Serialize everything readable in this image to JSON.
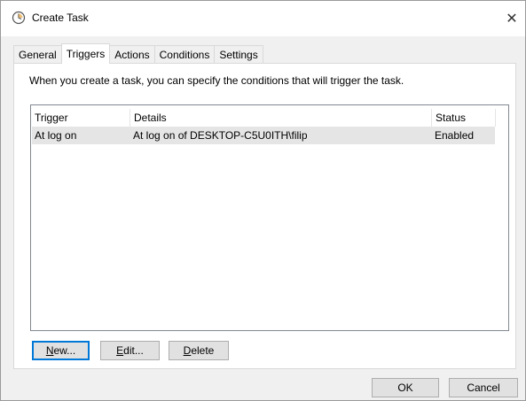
{
  "window": {
    "title": "Create Task",
    "close_glyph": "✕"
  },
  "tabs": [
    {
      "label": "General",
      "active": false
    },
    {
      "label": "Triggers",
      "active": true
    },
    {
      "label": "Actions",
      "active": false
    },
    {
      "label": "Conditions",
      "active": false
    },
    {
      "label": "Settings",
      "active": false
    }
  ],
  "triggers_panel": {
    "intro": "When you create a task, you can specify the conditions that will trigger the task.",
    "columns": [
      "Trigger",
      "Details",
      "Status"
    ],
    "rows": [
      {
        "trigger": "At log on",
        "details": "At log on of DESKTOP-C5U0ITH\\filip",
        "status": "Enabled",
        "selected": true
      }
    ],
    "buttons": {
      "new": {
        "mnemonic": "N",
        "rest": "ew..."
      },
      "edit": {
        "mnemonic": "E",
        "rest": "dit..."
      },
      "delete": {
        "mnemonic": "D",
        "rest": "elete"
      }
    }
  },
  "footer": {
    "ok": "OK",
    "cancel": "Cancel"
  },
  "colors": {
    "focus_border": "#0078d7",
    "selected_row": "#e5e5e5",
    "button_face": "#e1e1e1"
  },
  "icons": {
    "title": "clock-icon",
    "close": "close-icon"
  }
}
